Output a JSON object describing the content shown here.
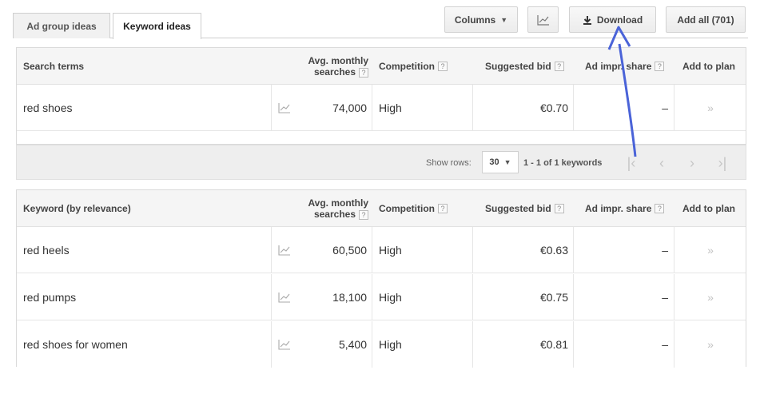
{
  "tabs": {
    "ad_group_ideas": "Ad group ideas",
    "keyword_ideas": "Keyword ideas"
  },
  "toolbar": {
    "columns_label": "Columns",
    "download_label": "Download",
    "add_all_label": "Add all (701)"
  },
  "columns": {
    "search_terms": "Search terms",
    "keyword_relevance": "Keyword (by relevance)",
    "avg_monthly_line1": "Avg. monthly",
    "avg_monthly_line2": "searches",
    "competition": "Competition",
    "suggested_bid": "Suggested bid",
    "ad_impr_share": "Ad impr. share",
    "add_to_plan": "Add to plan",
    "help_glyph": "?"
  },
  "search_terms_rows": [
    {
      "keyword": "red shoes",
      "searches": "74,000",
      "competition": "High",
      "bid": "€0.70",
      "impr_share": "–",
      "add": "»"
    }
  ],
  "pagination": {
    "show_rows_label": "Show rows:",
    "rows_value": "30",
    "range_text": "1 - 1 of 1 keywords"
  },
  "keyword_rows": [
    {
      "keyword": "red heels",
      "searches": "60,500",
      "competition": "High",
      "bid": "€0.63",
      "impr_share": "–",
      "add": "»"
    },
    {
      "keyword": "red pumps",
      "searches": "18,100",
      "competition": "High",
      "bid": "€0.75",
      "impr_share": "–",
      "add": "»"
    },
    {
      "keyword": "red shoes for women",
      "searches": "5,400",
      "competition": "High",
      "bid": "€0.81",
      "impr_share": "–",
      "add": "»"
    }
  ],
  "annotation": {
    "arrow_color": "#4a63d8"
  }
}
